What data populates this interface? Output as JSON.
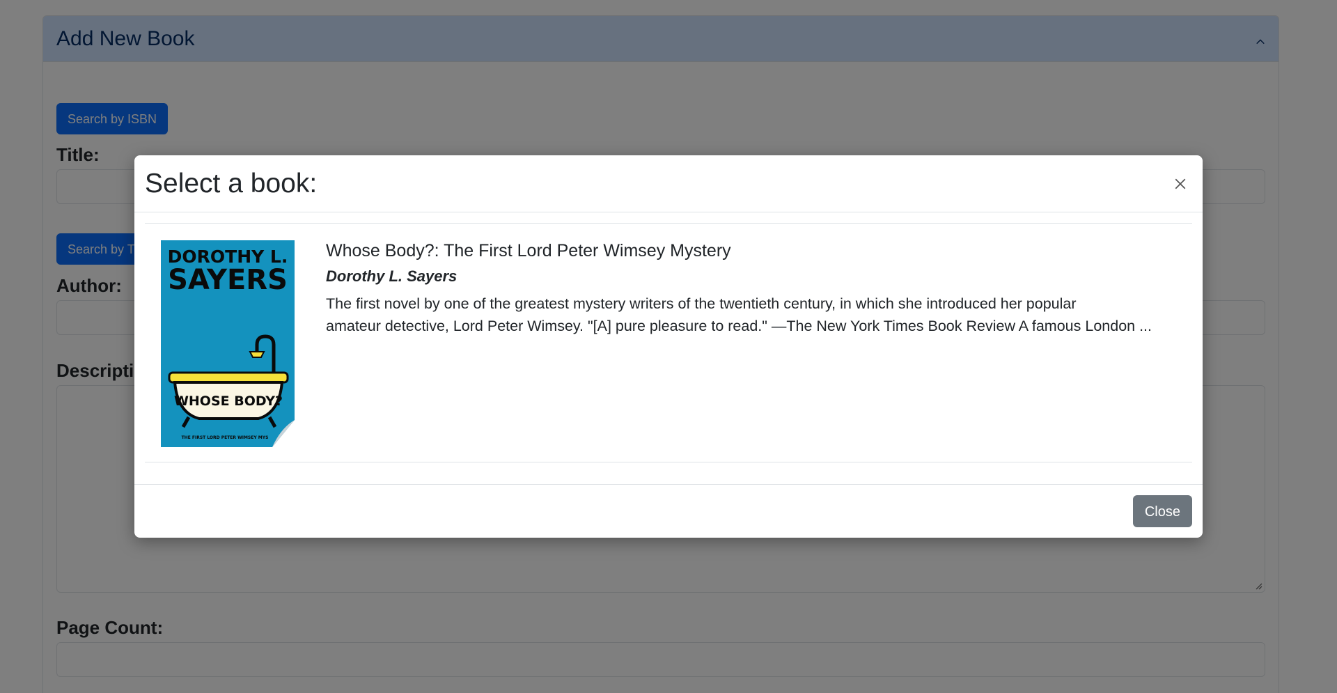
{
  "form": {
    "header_title": "Add New Book",
    "search_isbn_label": "Search by ISBN",
    "title_label": "Title:",
    "search_title_label": "Search by Title",
    "author_label": "Author:",
    "description_label": "Description:",
    "page_count_label": "Page Count:"
  },
  "modal": {
    "title": "Select a book:",
    "close_label": "Close",
    "results": [
      {
        "title": "Whose Body?: The First Lord Peter Wimsey Mystery",
        "author": "Dorothy L. Sayers",
        "description_line1": "The first novel by one of the greatest mystery writers of the twentieth century, in which she introduced her popular",
        "description_line2": "amateur detective, Lord Peter Wimsey. \"[A] pure pleasure to read.\" —The New York Times Book Review A famous London ...",
        "cover": {
          "author_line1": "DOROTHY L.",
          "author_line2": "SAYERS",
          "tub_text": "WHOSE BODY?",
          "subtitle": "THE FIRST LORD PETER WIMSEY MYS",
          "background_color": "#1492be",
          "tub_color": "#f6e03a"
        }
      }
    ]
  },
  "colors": {
    "primary": "#0d6efd",
    "secondary": "#6c757d",
    "accordion_header_bg": "#cfe2ff"
  }
}
